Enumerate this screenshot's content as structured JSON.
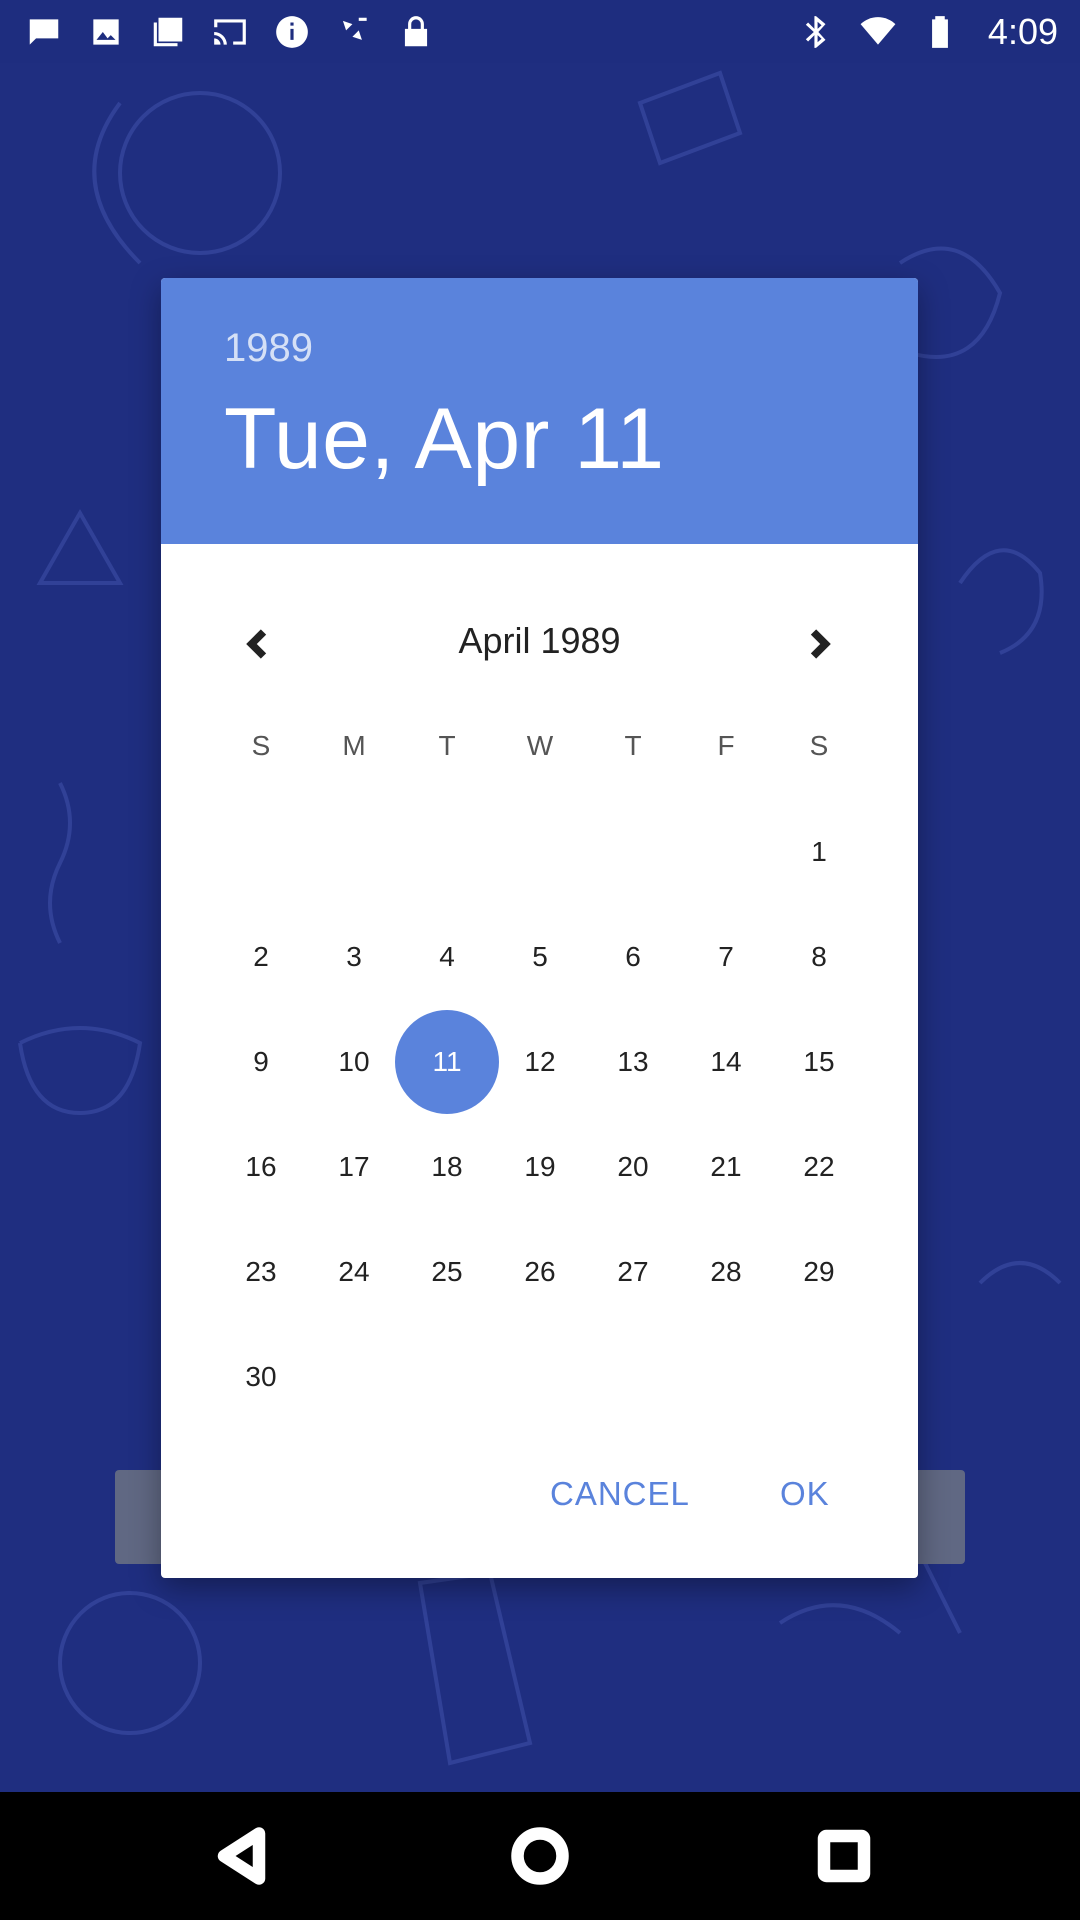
{
  "status_bar": {
    "time": "4:09",
    "icons": [
      "message-icon",
      "image-icon",
      "gallery-icon",
      "cast-icon",
      "info-icon",
      "fake-gps-icon",
      "lock-icon",
      "bluetooth-icon",
      "wifi-icon",
      "battery-icon"
    ]
  },
  "dialog": {
    "header": {
      "year": "1989",
      "date": "Tue, Apr 11"
    },
    "month_label": "April 1989",
    "weekdays": [
      "S",
      "M",
      "T",
      "W",
      "T",
      "F",
      "S"
    ],
    "weeks": [
      [
        "",
        "",
        "",
        "",
        "",
        "",
        "1"
      ],
      [
        "2",
        "3",
        "4",
        "5",
        "6",
        "7",
        "8"
      ],
      [
        "9",
        "10",
        "11",
        "12",
        "13",
        "14",
        "15"
      ],
      [
        "16",
        "17",
        "18",
        "19",
        "20",
        "21",
        "22"
      ],
      [
        "23",
        "24",
        "25",
        "26",
        "27",
        "28",
        "29"
      ],
      [
        "30",
        "",
        "",
        "",
        "",
        "",
        ""
      ]
    ],
    "selected_day": "11",
    "cancel_label": "CANCEL",
    "ok_label": "OK"
  },
  "colors": {
    "accent": "#5a83dc",
    "background": "#1f2e80",
    "status_bar": "#1e2d7f"
  }
}
